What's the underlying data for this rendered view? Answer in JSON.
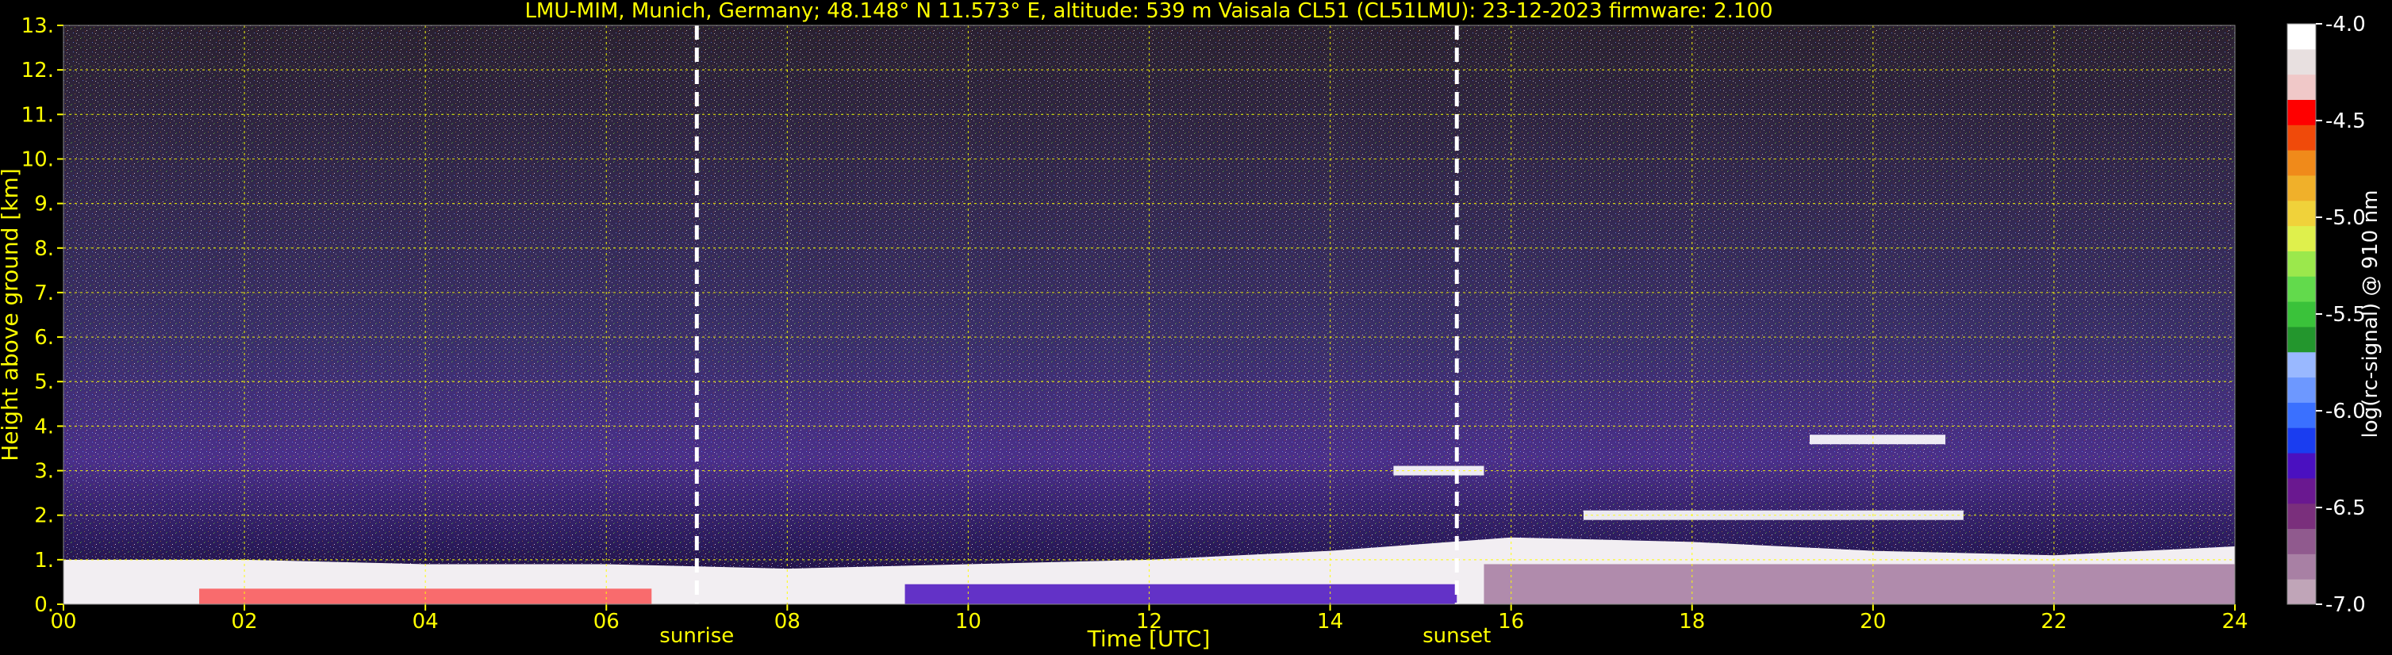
{
  "chart_data": {
    "type": "heatmap",
    "title": "LMU-MIM, Munich, Germany; 48.148° N 11.573° E, altitude: 539 m    Vaisala CL51 (CL51LMU): 23-12-2023    firmware: 2.100",
    "xlabel": "Time [UTC]",
    "ylabel": "Height above ground [km]",
    "xlim": [
      0,
      24
    ],
    "ylim": [
      0,
      13
    ],
    "x_ticks": [
      "00",
      "02",
      "04",
      "06",
      "08",
      "10",
      "12",
      "14",
      "16",
      "18",
      "20",
      "22",
      "24"
    ],
    "y_ticks": [
      "0.",
      "1.",
      "2.",
      "3.",
      "4.",
      "5.",
      "6.",
      "7.",
      "8.",
      "9.",
      "10.",
      "11.",
      "12.",
      "13."
    ],
    "grid": true,
    "annotations": [
      {
        "label": "sunrise",
        "x": 7.0
      },
      {
        "label": "sunset",
        "x": 15.4
      }
    ],
    "colorbar": {
      "label": "log(rc-signal) @ 910 nm",
      "range": [
        -7.0,
        -4.0
      ],
      "ticks": [
        "-4.0",
        "-4.5",
        "-5.0",
        "-5.5",
        "-6.0",
        "-6.5",
        "-7.0"
      ],
      "colors": [
        "#c0a5b8",
        "#a880a4",
        "#905a8e",
        "#7a2f7c",
        "#6a1890",
        "#4a10c0",
        "#1a3df0",
        "#3a70ff",
        "#6d98ff",
        "#99b8ff",
        "#23962d",
        "#3ac23a",
        "#62da4c",
        "#9be84c",
        "#dff04c",
        "#f0d23a",
        "#f0b02a",
        "#f08a1a",
        "#f04a0a",
        "#ff0000",
        "#f0c8c8",
        "#e8e0e0",
        "#ffffff"
      ]
    },
    "layers": [
      {
        "name": "surface aerosol layer",
        "x_range": [
          0,
          24
        ],
        "top_km": [
          1.0,
          1.0,
          0.9,
          0.9,
          0.8,
          0.9,
          1.0,
          1.2,
          1.5,
          1.4,
          1.2,
          1.1,
          1.3
        ]
      },
      {
        "name": "cloud",
        "x_range": [
          14.7,
          15.7
        ],
        "height_km": 3.0
      },
      {
        "name": "cloud",
        "x_range": [
          16.8,
          21.0
        ],
        "height_km": 2.0
      },
      {
        "name": "cloud",
        "x_range": [
          19.3,
          20.8
        ],
        "height_km": 3.7
      }
    ]
  }
}
